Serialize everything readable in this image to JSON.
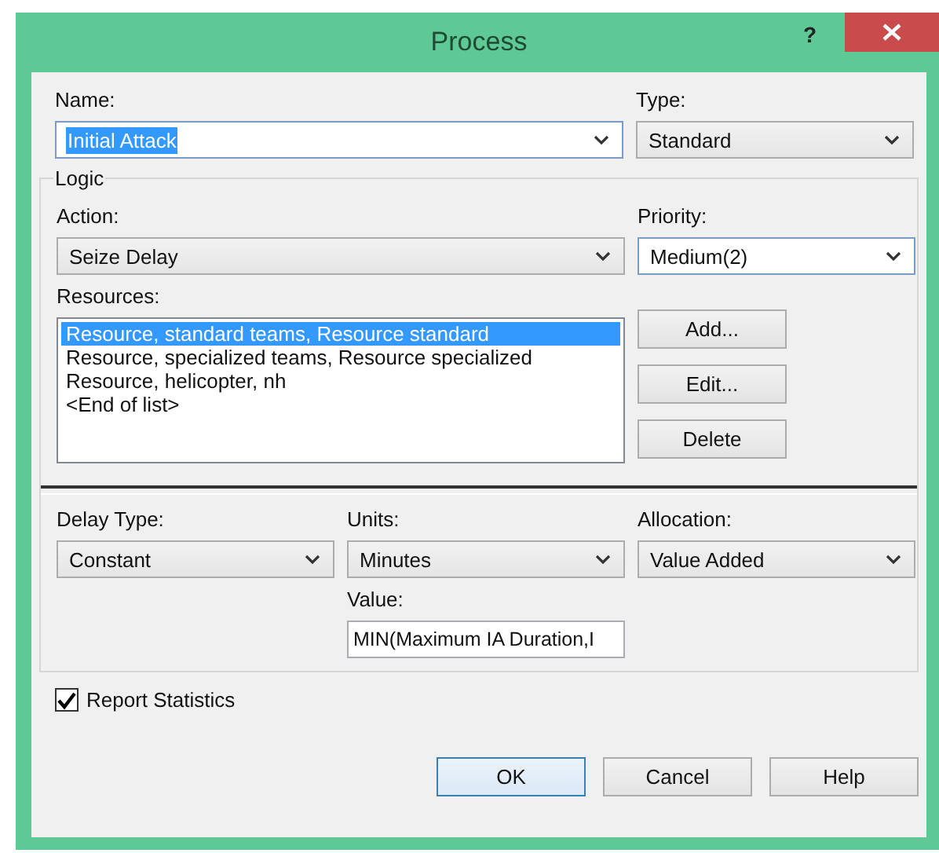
{
  "window": {
    "title": "Process",
    "help_button": "?"
  },
  "name": {
    "label": "Name:",
    "value": "Initial Attack",
    "editable": true,
    "highlighted": true
  },
  "type": {
    "label": "Type:",
    "value": "Standard",
    "editable": false
  },
  "logic": {
    "title": "Logic",
    "action": {
      "label": "Action:",
      "value": "Seize Delay",
      "editable": false
    },
    "priority": {
      "label": "Priority:",
      "value": "Medium(2)",
      "editable": true
    },
    "resources": {
      "label": "Resources:",
      "items": [
        {
          "text": "Resource, standard teams, Resource standard",
          "selected": true
        },
        {
          "text": "Resource, specialized teams, Resource specialized",
          "selected": false
        },
        {
          "text": "Resource, helicopter, nh",
          "selected": false
        },
        {
          "text": "<End of list>",
          "selected": false
        }
      ]
    },
    "buttons": [
      "Add...",
      "Edit...",
      "Delete"
    ],
    "delay_type": {
      "label": "Delay Type:",
      "value": "Constant",
      "editable": false
    },
    "units": {
      "label": "Units:",
      "value": "Minutes",
      "editable": false
    },
    "allocation": {
      "label": "Allocation:",
      "value": "Value Added",
      "editable": false
    },
    "value": {
      "label": "Value:",
      "value": "MIN(Maximum IA Duration,I"
    }
  },
  "report_statistics": {
    "label": "Report Statistics",
    "checked": true
  },
  "buttons": [
    {
      "label": "OK",
      "default": true
    },
    {
      "label": "Cancel",
      "default": false
    },
    {
      "label": "Help",
      "default": false
    }
  ]
}
